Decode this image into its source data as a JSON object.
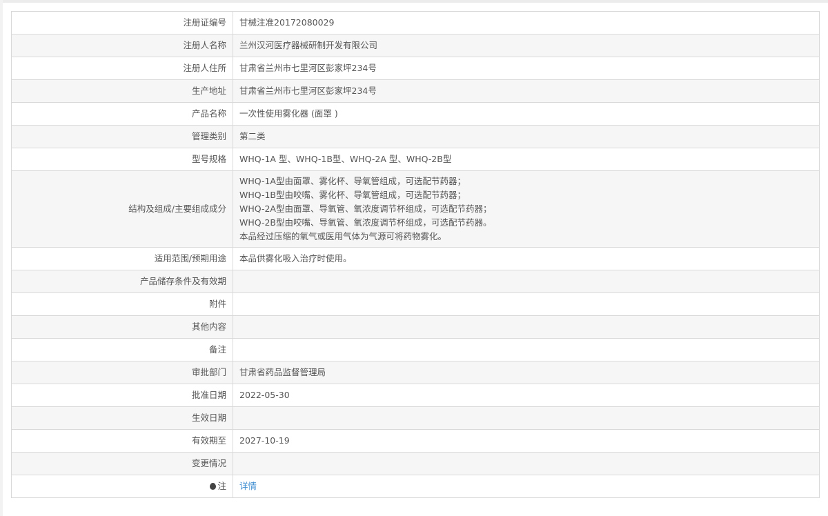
{
  "rows": [
    {
      "label": "注册证编号",
      "value": "甘械注准20172080029"
    },
    {
      "label": "注册人名称",
      "value": "兰州汉河医疗器械研制开发有限公司"
    },
    {
      "label": "注册人住所",
      "value": "甘肃省兰州市七里河区彭家坪234号"
    },
    {
      "label": "生产地址",
      "value": "甘肃省兰州市七里河区彭家坪234号"
    },
    {
      "label": "产品名称",
      "value": "一次性使用雾化器 (面罩 )"
    },
    {
      "label": "管理类别",
      "value": "第二类"
    },
    {
      "label": "型号规格",
      "value": "WHQ-1A 型、WHQ-1B型、WHQ-2A 型、WHQ-2B型"
    },
    {
      "label": "结构及组成/主要组成成分",
      "lines": [
        "WHQ-1A型由面罩、雾化杯、导氧管组成，可选配节药器；",
        "WHQ-1B型由咬嘴、雾化杯、导氧管组成，可选配节药器；",
        "WHQ-2A型由面罩、导氧管、氧浓度调节杯组成，可选配节药器；",
        "WHQ-2B型由咬嘴、导氧管、氧浓度调节杯组成，可选配节药器。",
        "本品经过压缩的氧气或医用气体为气源可将药物雾化。"
      ]
    },
    {
      "label": "适用范围/预期用途",
      "value": "本品供雾化吸入治疗时使用。"
    },
    {
      "label": "产品储存条件及有效期",
      "value": ""
    },
    {
      "label": "附件",
      "value": ""
    },
    {
      "label": "其他内容",
      "value": ""
    },
    {
      "label": "备注",
      "value": ""
    },
    {
      "label": "审批部门",
      "value": "甘肃省药品监督管理局"
    },
    {
      "label": "批准日期",
      "value": "2022-05-30"
    },
    {
      "label": "生效日期",
      "value": ""
    },
    {
      "label": "有效期至",
      "value": "2027-10-19"
    },
    {
      "label": "变更情况",
      "value": ""
    }
  ],
  "note": {
    "label": "注",
    "icon": "lightbulb-icon",
    "link": "详情"
  }
}
